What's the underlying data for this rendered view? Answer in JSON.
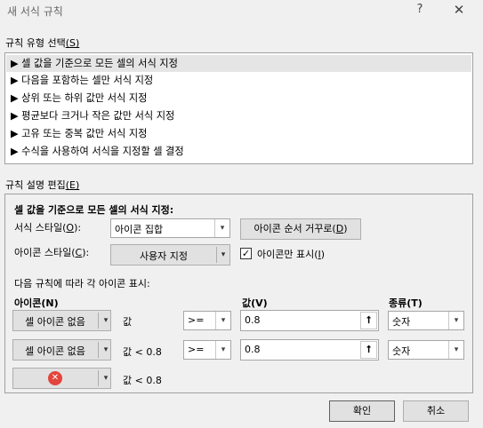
{
  "window": {
    "title": "새 서식 규칙",
    "help_icon": "?",
    "close_icon": "✕"
  },
  "rule_type": {
    "label": "규칙 유형 선택",
    "accel": "(S)",
    "items": [
      {
        "label": "▶ 셀 값을 기준으로 모든 셀의 서식 지정",
        "selected": true
      },
      {
        "label": "▶ 다음을 포함하는 셀만 서식 지정"
      },
      {
        "label": "▶ 상위 또는 하위 값만 서식 지정"
      },
      {
        "label": "▶ 평균보다 크거나 작은 값만 서식 지정"
      },
      {
        "label": "▶ 고유 또는 중복 값만 서식 지정"
      },
      {
        "label": "▶ 수식을 사용하여 서식을 지정할 셀 결정"
      }
    ]
  },
  "rule_desc": {
    "label": "규칙 설명 편집",
    "accel": "(E)",
    "heading": "셀 값을 기준으로 모든 셀의 서식 지정:",
    "format_style_label": "서식 스타일(",
    "format_style_accel": "O",
    "format_style_end": "):",
    "format_style_value": "아이콘 집합",
    "reverse_button": "아이콘 순서 거꾸로(",
    "reverse_accel": "D",
    "reverse_end": ")",
    "icon_style_label": "아이콘 스타일(",
    "icon_style_accel": "C",
    "icon_style_end": "):",
    "icon_style_value": "사용자 지정",
    "icon_only_label": "아이콘만 표시(",
    "icon_only_accel": "I",
    "icon_only_end": ")",
    "icon_only_checked": "✓",
    "rules_caption": "다음 규칙에 따라 각 아이콘 표시:",
    "col_icon": "아이콘(N)",
    "col_value": "값(V)",
    "col_type": "종류(T)",
    "rows": [
      {
        "icon": "셀 아이콘 없음",
        "cond": "값",
        "op": ">=",
        "value": "0.8",
        "type": "숫자"
      },
      {
        "icon": "셀 아이콘 없음",
        "cond": "값 < 0.8",
        "op": ">=",
        "value": "0.8",
        "type": "숫자"
      },
      {
        "icon_glyph": "✕",
        "cond": "값 < 0.8"
      }
    ]
  },
  "footer": {
    "ok": "확인",
    "cancel": "취소"
  },
  "colors": {
    "selection": "#e5e5e5",
    "error_icon": "#e2453c",
    "dialog_bg": "#f0f0f0"
  }
}
